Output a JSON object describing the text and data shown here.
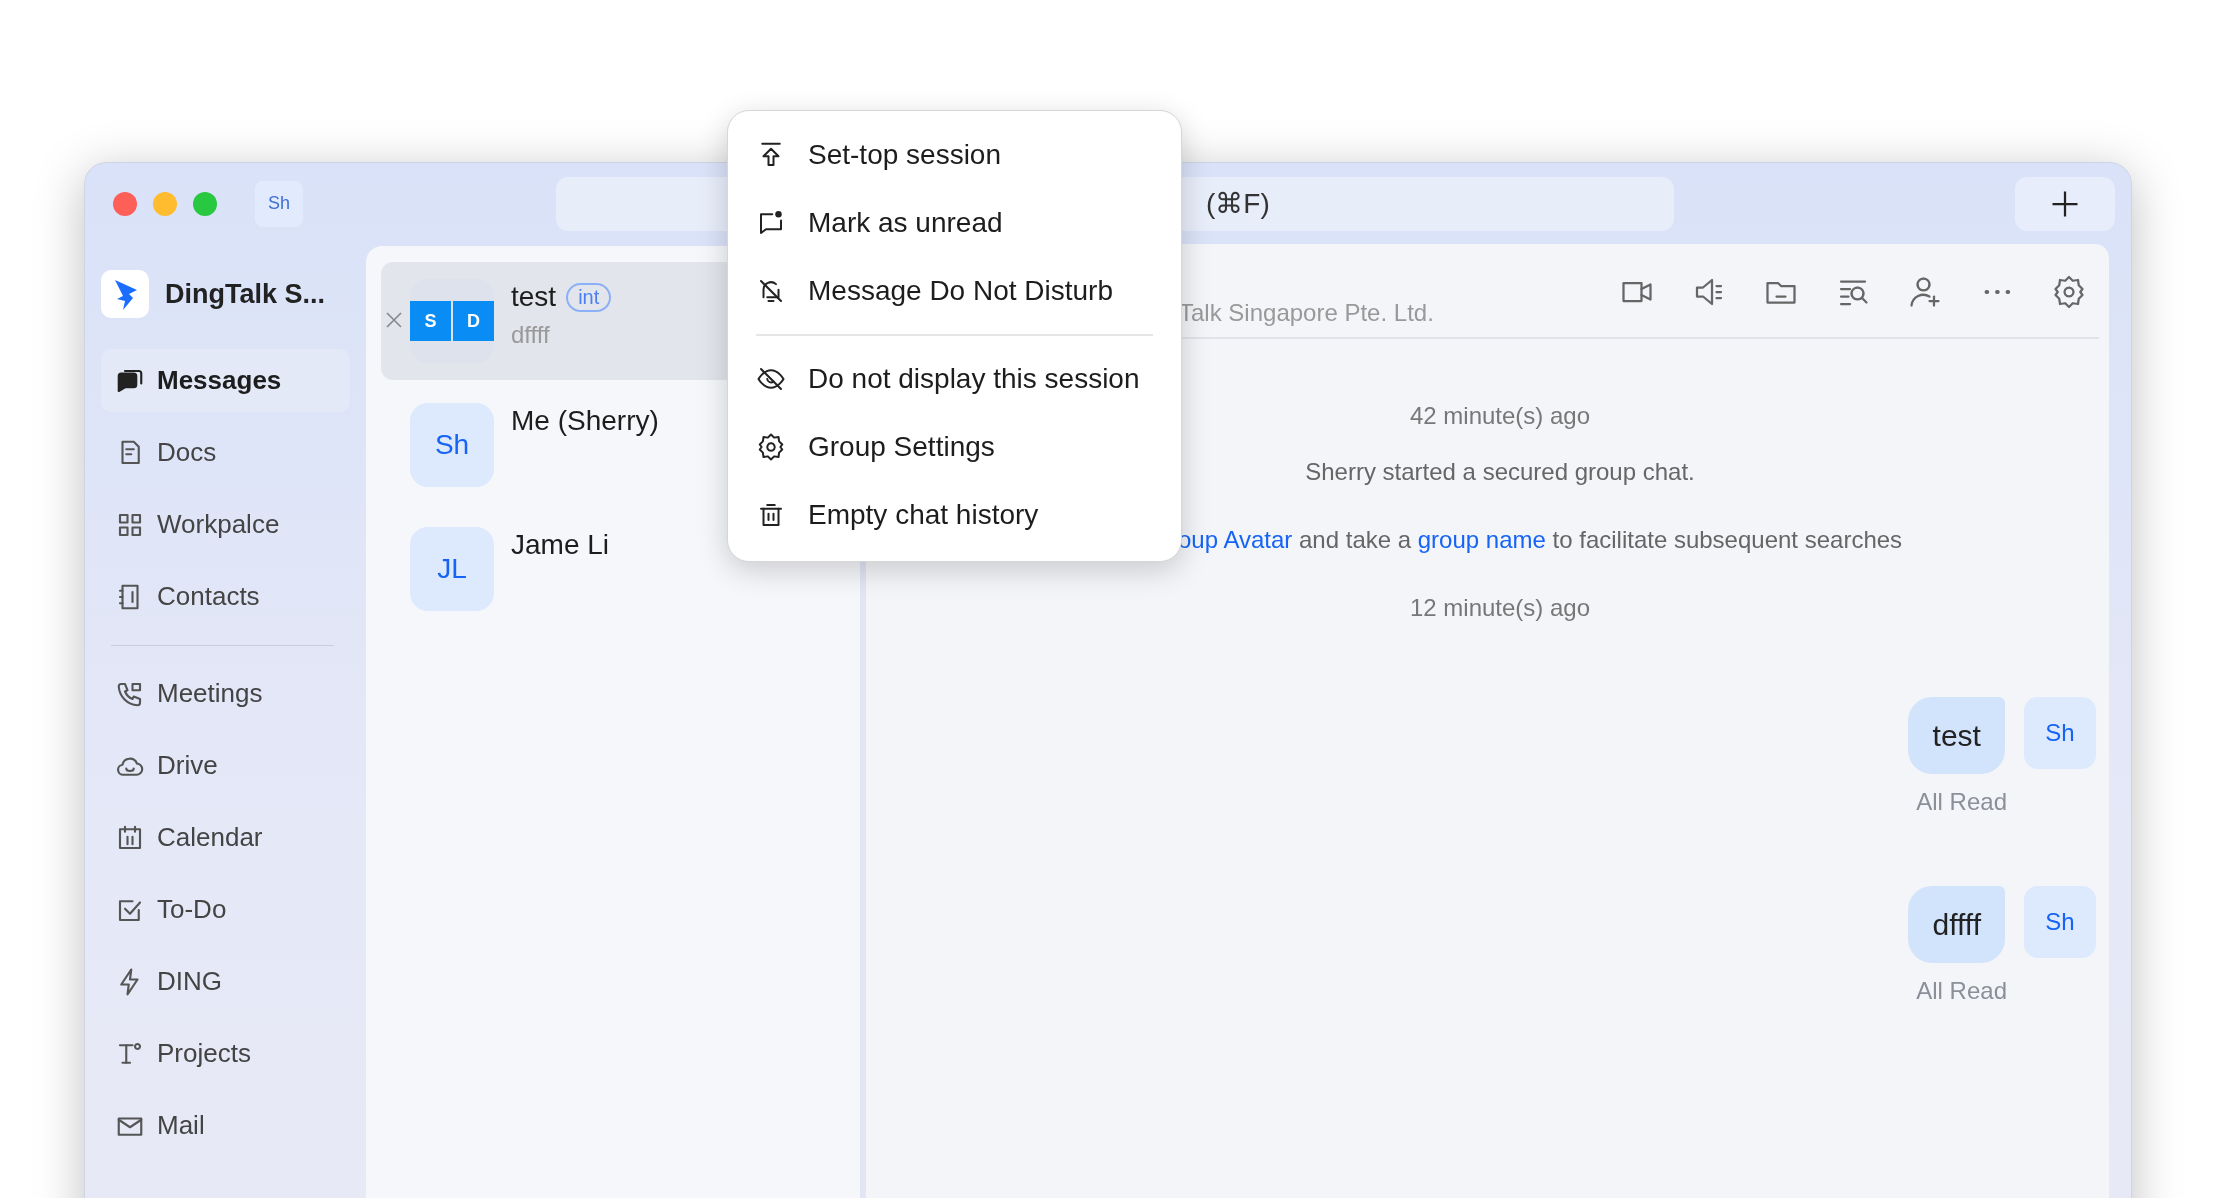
{
  "window": {
    "account_avatar": "Sh"
  },
  "search": {
    "placeholder": "(⌘F)"
  },
  "sidebar": {
    "org_name": "DingTalk S...",
    "sections": [
      {
        "items": [
          {
            "label": "Messages",
            "selected": true
          },
          {
            "label": "Docs",
            "selected": false
          },
          {
            "label": "Workpalce",
            "selected": false
          },
          {
            "label": "Contacts",
            "selected": false
          }
        ]
      },
      {
        "items": [
          {
            "label": "Meetings",
            "selected": false
          },
          {
            "label": "Drive",
            "selected": false
          },
          {
            "label": "Calendar",
            "selected": false
          },
          {
            "label": "To-Do",
            "selected": false
          },
          {
            "label": "DING",
            "selected": false
          },
          {
            "label": "Projects",
            "selected": false
          },
          {
            "label": "Mail",
            "selected": false
          }
        ]
      }
    ]
  },
  "conversations": [
    {
      "name": "test",
      "tag": "int",
      "preview": "dffff",
      "avatar": {
        "kind": "group",
        "letters": [
          "S",
          "D"
        ]
      },
      "selected": true
    },
    {
      "name": "Me (Sherry)",
      "avatar": {
        "kind": "initials",
        "text": "Sh"
      },
      "selected": false
    },
    {
      "name": "Jame Li",
      "avatar": {
        "kind": "initials",
        "text": "JL"
      },
      "selected": false
    }
  ],
  "chat": {
    "subtitle": "Talk Singapore Pte. Ltd.",
    "timeline": [
      {
        "kind": "time",
        "text": "42 minute(s) ago"
      },
      {
        "kind": "system",
        "text": "Sherry started a secured group chat."
      },
      {
        "kind": "notice",
        "parts": [
          {
            "text": "oup Avatar",
            "link": true
          },
          {
            "text": " and take a ",
            "link": false
          },
          {
            "text": "group name",
            "link": true
          },
          {
            "text": " to facilitate subsequent searches",
            "link": false
          }
        ]
      },
      {
        "kind": "time",
        "text": "12 minute(s) ago"
      },
      {
        "kind": "message",
        "text": "test",
        "avatar": "Sh",
        "receipt": "All Read"
      },
      {
        "kind": "message",
        "text": "dffff",
        "avatar": "Sh",
        "receipt": "All Read"
      }
    ]
  },
  "context_menu": {
    "groups": [
      {
        "items": [
          {
            "label": "Set-top session"
          },
          {
            "label": "Mark as unread"
          },
          {
            "label": "Message Do Not Disturb"
          }
        ]
      },
      {
        "items": [
          {
            "label": "Do not display this session"
          },
          {
            "label": "Group Settings"
          },
          {
            "label": "Empty chat history"
          }
        ]
      }
    ]
  }
}
